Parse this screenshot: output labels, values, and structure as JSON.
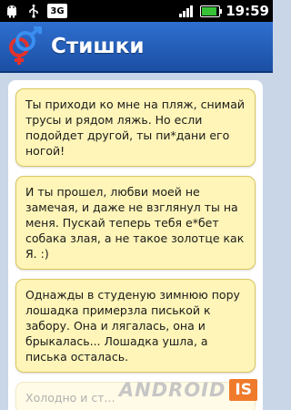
{
  "status_bar": {
    "network": "3G",
    "time": "19:59",
    "battery_level": 0.9,
    "icons": [
      "android-debug-icon",
      "usb-icon",
      "3g-icon",
      "signal-icon",
      "battery-icon"
    ]
  },
  "app": {
    "title": "Стишки",
    "logo_icon": "gender-symbols-icon",
    "colors": {
      "titlebar": "#2f6fd0",
      "card_bg": "#fff5b8",
      "card_border": "#d9c65e"
    }
  },
  "poems": [
    {
      "text": "Ты приходи ко мне на пляж, снимай трусы и рядом ляжь. Но если подойдет другой, ты пи*дани его ногой!"
    },
    {
      "text": "И ты прошел, любви моей не замечая, и даже не взглянул ты на меня. Пускай теперь тебя е*бет собака злая, а не такое золотце как Я. :)"
    },
    {
      "text": "Однажды в студеную зимнюю пору лошадка примерзла писькой к забору. Она и лягалась, она и брыкалась... Лошадка ушла, а писька осталась."
    },
    {
      "text": "Холодно и ст..."
    }
  ],
  "watermark": {
    "text": "ANDROID",
    "badge": "IS"
  }
}
